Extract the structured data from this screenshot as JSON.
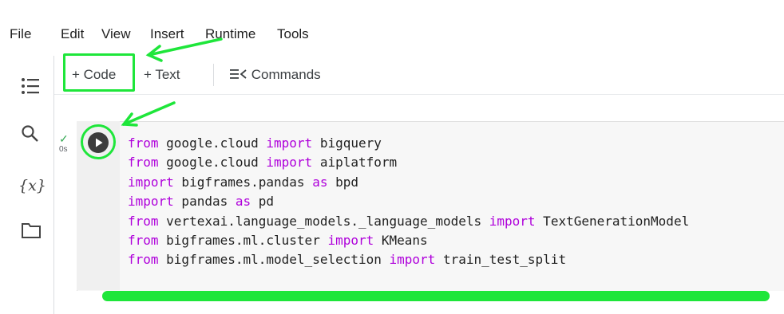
{
  "menu": [
    "File",
    "Edit",
    "View",
    "Insert",
    "Runtime",
    "Tools"
  ],
  "toolbar": {
    "code_label": "+ Code",
    "text_label": "+ Text",
    "commands_label": "Commands"
  },
  "sidebar": {
    "icons": [
      "toc-icon",
      "search-icon",
      "variables-icon",
      "folder-icon"
    ],
    "variables_label": "{x}"
  },
  "cell": {
    "status_check": "✓",
    "exec_time": "0s",
    "lines": [
      [
        {
          "t": "from",
          "k": true
        },
        {
          "t": " google.cloud ",
          "k": false
        },
        {
          "t": "import",
          "k": true
        },
        {
          "t": " bigquery",
          "k": false
        }
      ],
      [
        {
          "t": "from",
          "k": true
        },
        {
          "t": " google.cloud ",
          "k": false
        },
        {
          "t": "import",
          "k": true
        },
        {
          "t": " aiplatform",
          "k": false
        }
      ],
      [
        {
          "t": "import",
          "k": true
        },
        {
          "t": " bigframes.pandas ",
          "k": false
        },
        {
          "t": "as",
          "k": true
        },
        {
          "t": " bpd",
          "k": false
        }
      ],
      [
        {
          "t": "import",
          "k": true
        },
        {
          "t": " pandas ",
          "k": false
        },
        {
          "t": "as",
          "k": true
        },
        {
          "t": " pd",
          "k": false
        }
      ],
      [
        {
          "t": "from",
          "k": true
        },
        {
          "t": " vertexai.language_models._language_models ",
          "k": false
        },
        {
          "t": "import",
          "k": true
        },
        {
          "t": " TextGenerationModel",
          "k": false
        }
      ],
      [
        {
          "t": "from",
          "k": true
        },
        {
          "t": " bigframes.ml.cluster ",
          "k": false
        },
        {
          "t": "import",
          "k": true
        },
        {
          "t": " KMeans",
          "k": false
        }
      ],
      [
        {
          "t": "from",
          "k": true
        },
        {
          "t": " bigframes.ml.model_selection ",
          "k": false
        },
        {
          "t": "import",
          "k": true
        },
        {
          "t": " train_test_split",
          "k": false
        }
      ]
    ]
  },
  "colors": {
    "highlight": "#1ee63a",
    "keyword": "#af00db"
  }
}
